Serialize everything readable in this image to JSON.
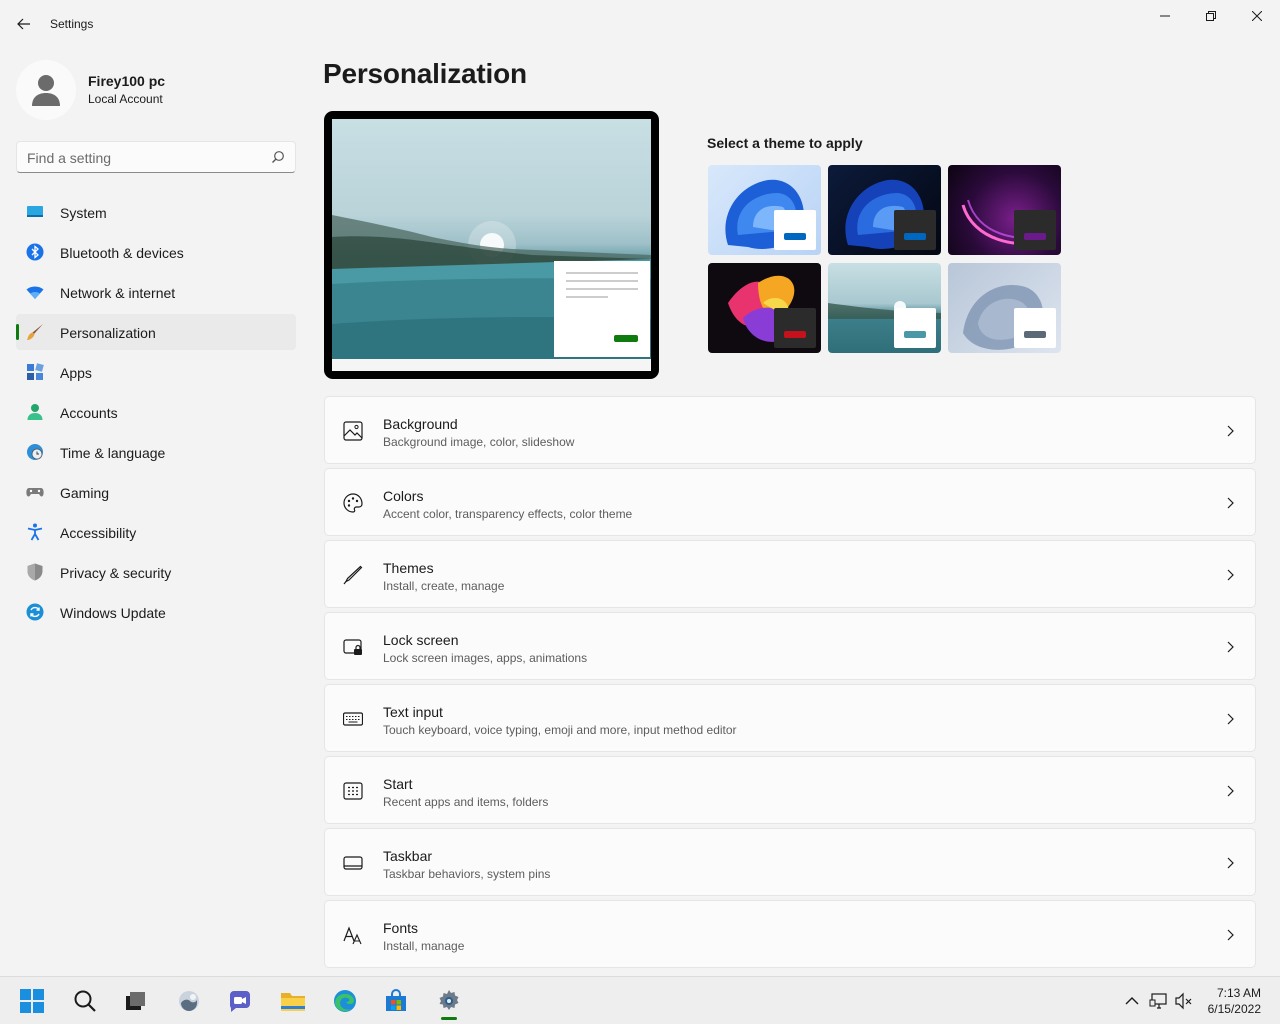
{
  "window": {
    "title": "Settings"
  },
  "profile": {
    "name": "Firey100 pc",
    "account_type": "Local Account"
  },
  "search": {
    "placeholder": "Find a setting"
  },
  "sidebar": {
    "items": [
      {
        "label": "System",
        "icon": "system-icon"
      },
      {
        "label": "Bluetooth & devices",
        "icon": "bluetooth-icon"
      },
      {
        "label": "Network & internet",
        "icon": "wifi-icon"
      },
      {
        "label": "Personalization",
        "icon": "brush-icon",
        "active": true
      },
      {
        "label": "Apps",
        "icon": "apps-icon"
      },
      {
        "label": "Accounts",
        "icon": "person-icon"
      },
      {
        "label": "Time & language",
        "icon": "globe-clock-icon"
      },
      {
        "label": "Gaming",
        "icon": "controller-icon"
      },
      {
        "label": "Accessibility",
        "icon": "accessibility-icon"
      },
      {
        "label": "Privacy & security",
        "icon": "shield-icon"
      },
      {
        "label": "Windows Update",
        "icon": "update-icon"
      }
    ]
  },
  "main": {
    "title": "Personalization",
    "theme_heading": "Select a theme to apply",
    "themes": [
      {
        "name": "windows-light-theme",
        "accent": "#0067c0"
      },
      {
        "name": "windows-dark-theme",
        "accent": "#0067c0"
      },
      {
        "name": "glow-theme",
        "accent": "#6b1a8c"
      },
      {
        "name": "captured-motion-theme",
        "accent": "#c4111b"
      },
      {
        "name": "sunrise-theme",
        "accent": "#4a97a6"
      },
      {
        "name": "flow-theme",
        "accent": "#5b6a76"
      }
    ],
    "cards": [
      {
        "title": "Background",
        "subtitle": "Background image, color, slideshow",
        "icon": "image-icon"
      },
      {
        "title": "Colors",
        "subtitle": "Accent color, transparency effects, color theme",
        "icon": "palette-icon"
      },
      {
        "title": "Themes",
        "subtitle": "Install, create, manage",
        "icon": "pen-icon"
      },
      {
        "title": "Lock screen",
        "subtitle": "Lock screen images, apps, animations",
        "icon": "lock-screen-icon"
      },
      {
        "title": "Text input",
        "subtitle": "Touch keyboard, voice typing, emoji and more, input method editor",
        "icon": "keyboard-icon"
      },
      {
        "title": "Start",
        "subtitle": "Recent apps and items, folders",
        "icon": "start-icon"
      },
      {
        "title": "Taskbar",
        "subtitle": "Taskbar behaviors, system pins",
        "icon": "taskbar-icon"
      },
      {
        "title": "Fonts",
        "subtitle": "Install, manage",
        "icon": "fonts-icon"
      }
    ]
  },
  "colors": {
    "accent": "#0f7b0f",
    "preview_button": "#0f7b0f"
  },
  "taskbar": {
    "apps": [
      "start-icon",
      "search-icon",
      "task-view-icon",
      "widgets-icon",
      "chat-icon",
      "file-explorer-icon",
      "edge-icon",
      "store-icon",
      "settings-icon"
    ],
    "time": "7:13 AM",
    "date": "6/15/2022"
  }
}
